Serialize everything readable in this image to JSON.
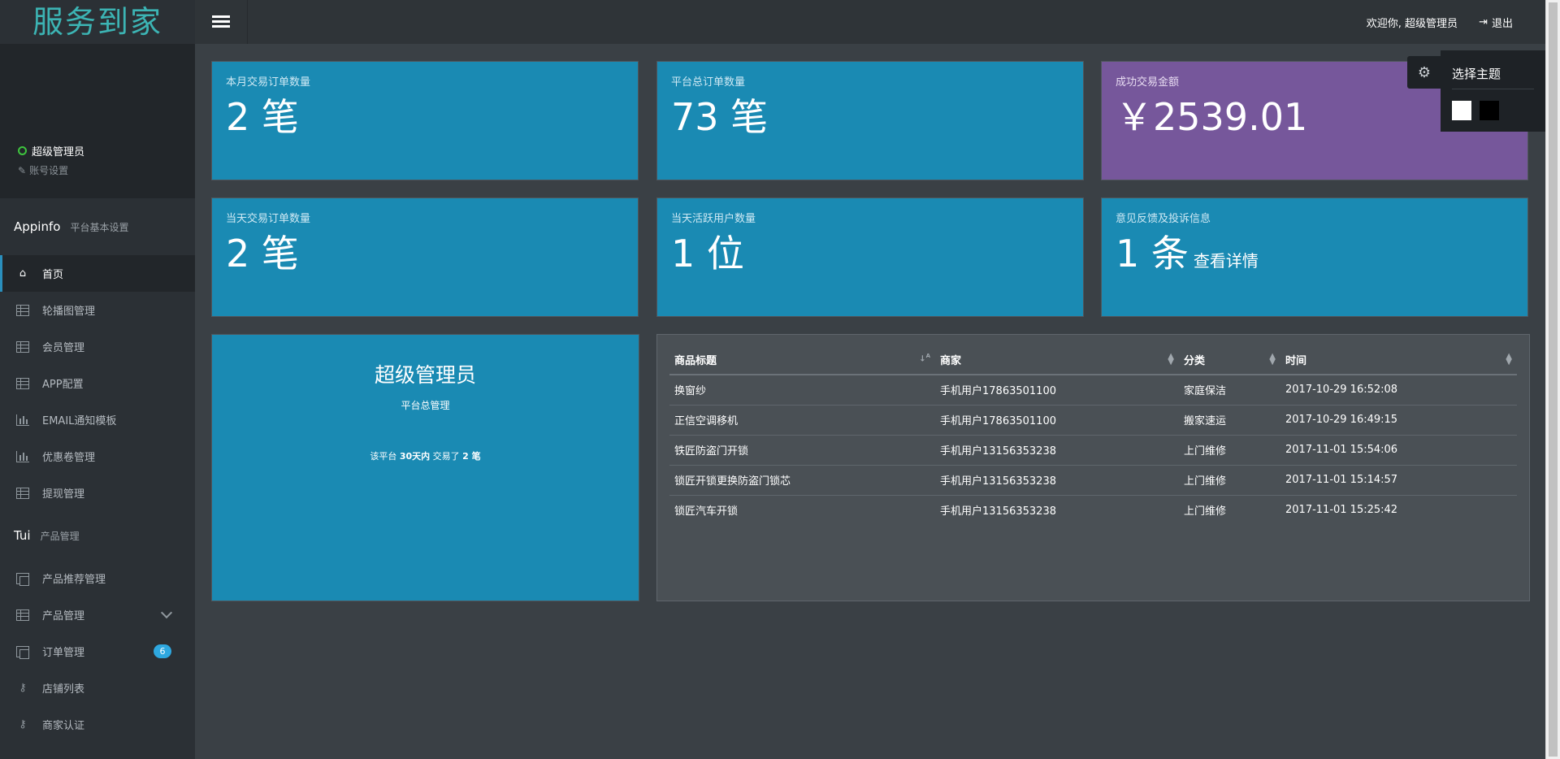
{
  "brand": "服务到家",
  "profile": {
    "name": "超级管理员",
    "account_settings": "账号设置"
  },
  "sections": [
    {
      "big": "Appinfo",
      "small": "平台基本设置"
    },
    {
      "big": "Tui",
      "small": "产品管理"
    }
  ],
  "nav1": [
    {
      "label": "首页",
      "icon": "home-icon"
    },
    {
      "label": "轮播图管理",
      "icon": "grid-icon"
    },
    {
      "label": "会员管理",
      "icon": "grid-icon"
    },
    {
      "label": "APP配置",
      "icon": "grid-icon"
    },
    {
      "label": "EMAIL通知模板",
      "icon": "bar-chart-icon"
    },
    {
      "label": "优惠卷管理",
      "icon": "bar-chart-icon"
    },
    {
      "label": "提现管理",
      "icon": "grid-icon"
    }
  ],
  "nav2": [
    {
      "label": "产品推荐管理",
      "icon": "copy-icon"
    },
    {
      "label": "产品管理",
      "icon": "grid-icon"
    },
    {
      "label": "订单管理",
      "icon": "copy-icon",
      "badge": "6"
    },
    {
      "label": "店铺列表",
      "icon": "key-icon"
    },
    {
      "label": "商家认证",
      "icon": "key-icon"
    }
  ],
  "topbar": {
    "welcome": "欢迎你, 超级管理员",
    "logout": "退出"
  },
  "cards": [
    {
      "label": "本月交易订单数量",
      "value": "2 笔"
    },
    {
      "label": "平台总订单数量",
      "value": "73 笔"
    },
    {
      "label": "成功交易金额",
      "value": "￥2539.01"
    },
    {
      "label": "当天交易订单数量",
      "value": "2 笔"
    },
    {
      "label": "当天活跃用户数量",
      "value": "1 位"
    },
    {
      "label": "意见反馈及投诉信息",
      "value": "1 条",
      "link": "查看详情"
    }
  ],
  "admin_panel": {
    "title": "超级管理员",
    "subtitle": "平台总管理",
    "note_prefix": "该平台",
    "note_bold1": "30天内",
    "note_mid": "交易了",
    "note_bold2": "2 笔"
  },
  "table": {
    "headers": [
      "商品标题",
      "商家",
      "分类",
      "时间"
    ],
    "rows": [
      [
        "换窗纱",
        "手机用户17863501100",
        "家庭保洁",
        "2017-10-29 16:52:08"
      ],
      [
        "正信空调移机",
        "手机用户17863501100",
        "搬家速运",
        "2017-10-29 16:49:15"
      ],
      [
        "铁匠防盗门开锁",
        "手机用户13156353238",
        "上门维修",
        "2017-11-01 15:54:06"
      ],
      [
        "锁匠开锁更换防盗门锁芯",
        "手机用户13156353238",
        "上门维修",
        "2017-11-01 15:14:57"
      ],
      [
        "锁匠汽车开锁",
        "手机用户13156353238",
        "上门维修",
        "2017-11-01 15:25:42"
      ]
    ]
  },
  "theme": {
    "title": "选择主题",
    "swatches": [
      "#ffffff",
      "#000000"
    ]
  },
  "colors": {
    "card_blue": "#1a8ab3",
    "card_purple": "#76579b",
    "accent": "#2ea8e0"
  }
}
